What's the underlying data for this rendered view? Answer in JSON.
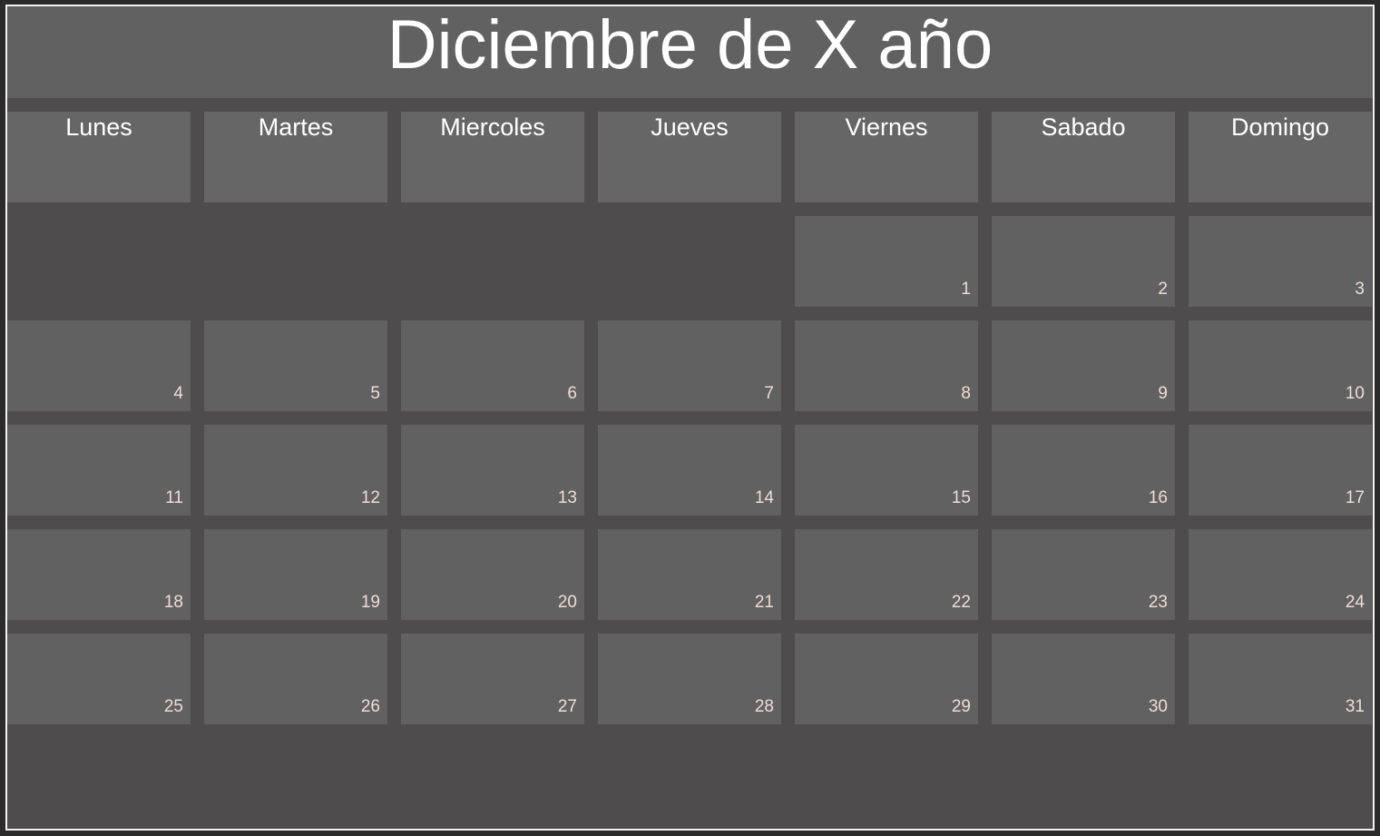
{
  "calendar": {
    "title": "Diciembre de X año",
    "weekdays": [
      "Lunes",
      "Martes",
      "Miercoles",
      "Jueves",
      "Viernes",
      "Sabado",
      "Domingo"
    ],
    "days": [
      "",
      "",
      "",
      "",
      "1",
      "2",
      "3",
      "4",
      "5",
      "6",
      "7",
      "8",
      "9",
      "10",
      "11",
      "12",
      "13",
      "14",
      "15",
      "16",
      "17",
      "18",
      "19",
      "20",
      "21",
      "22",
      "23",
      "24",
      "25",
      "26",
      "27",
      "28",
      "29",
      "30",
      "31"
    ]
  },
  "colors": {
    "background": "#4e4c4d",
    "cell": "#616161",
    "header_cell": "#666666",
    "title_text": "#ffffff",
    "day_number": "#f0dcd6",
    "frame_border": "#f2f2f2"
  }
}
